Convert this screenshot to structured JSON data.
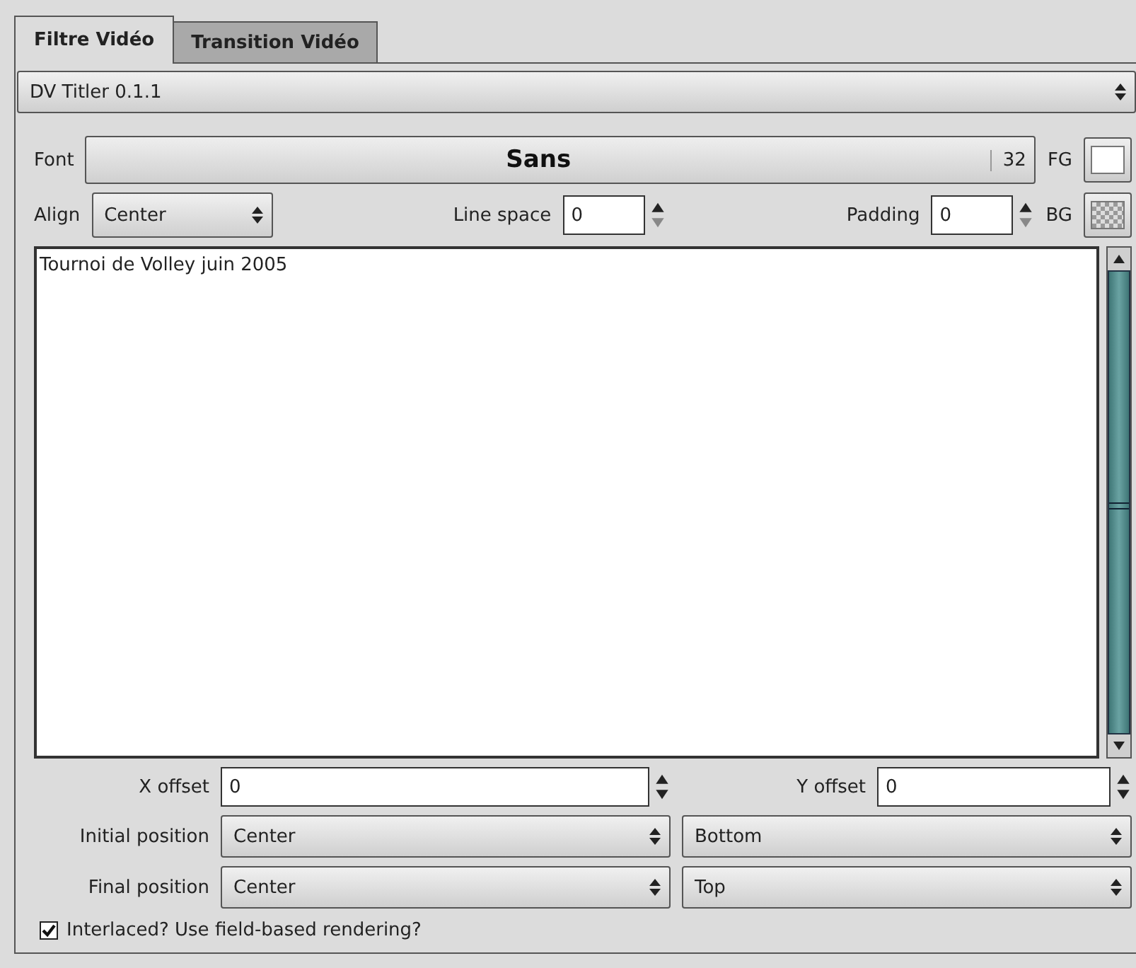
{
  "tabs": [
    {
      "label": "Filtre Vidéo",
      "selected": true
    },
    {
      "label": "Transition Vidéo",
      "selected": false
    }
  ],
  "plugin": {
    "value": "DV Titler 0.1.1"
  },
  "font": {
    "label": "Font",
    "name": "Sans",
    "size": "32",
    "fg_label": "FG"
  },
  "align": {
    "label": "Align",
    "value": "Center"
  },
  "line_space": {
    "label": "Line space",
    "value": "0"
  },
  "padding": {
    "label": "Padding",
    "value": "0",
    "bg_label": "BG"
  },
  "text": "Tournoi de Volley juin 2005",
  "x_offset": {
    "label": "X offset",
    "value": "0"
  },
  "y_offset": {
    "label": "Y offset",
    "value": "0"
  },
  "initial_position": {
    "label": "Initial position",
    "horizontal": "Center",
    "vertical": "Bottom"
  },
  "final_position": {
    "label": "Final position",
    "horizontal": "Center",
    "vertical": "Top"
  },
  "interlaced": {
    "label": "Interlaced? Use field-based rendering?",
    "checked": true
  }
}
